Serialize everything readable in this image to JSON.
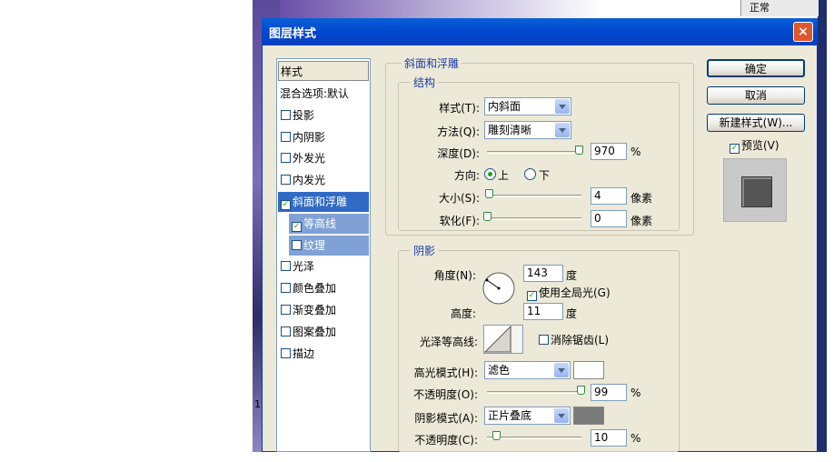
{
  "background": {
    "status_text": "正常",
    "edge_number": "1"
  },
  "dialog": {
    "title": "图层样式",
    "close": "×"
  },
  "styles_list": {
    "header": "样式",
    "items": [
      {
        "label": "混合选项:默认",
        "checkbox": false
      },
      {
        "label": "投影",
        "checkbox": true,
        "checked": false
      },
      {
        "label": "内阴影",
        "checkbox": true,
        "checked": false
      },
      {
        "label": "外发光",
        "checkbox": true,
        "checked": false
      },
      {
        "label": "内发光",
        "checkbox": true,
        "checked": false
      },
      {
        "label": "斜面和浮雕",
        "checkbox": true,
        "checked": true,
        "selected": true
      },
      {
        "label": "等高线",
        "checkbox": true,
        "checked": true,
        "sub": true
      },
      {
        "label": "纹理",
        "checkbox": true,
        "checked": false,
        "sub": true
      },
      {
        "label": "光泽",
        "checkbox": true,
        "checked": false
      },
      {
        "label": "颜色叠加",
        "checkbox": true,
        "checked": false
      },
      {
        "label": "渐变叠加",
        "checkbox": true,
        "checked": false
      },
      {
        "label": "图案叠加",
        "checkbox": true,
        "checked": false
      },
      {
        "label": "描边",
        "checkbox": true,
        "checked": false
      }
    ]
  },
  "bevel": {
    "section_title": "斜面和浮雕",
    "structure_title": "结构",
    "style_label": "样式(T):",
    "style_value": "内斜面",
    "technique_label": "方法(Q):",
    "technique_value": "雕刻清晰",
    "depth_label": "深度(D):",
    "depth_value": "970",
    "depth_unit": "%",
    "depth_slider": 0.97,
    "direction_label": "方向:",
    "direction_up": "上",
    "direction_down": "下",
    "direction_selected": "上",
    "size_label": "大小(S):",
    "size_value": "4",
    "size_unit": "像素",
    "size_slider": 0.02,
    "soften_label": "软化(F):",
    "soften_value": "0",
    "soften_unit": "像素",
    "soften_slider": 0.0
  },
  "shading": {
    "title": "阴影",
    "angle_label": "角度(N):",
    "angle_value": "143",
    "angle_unit": "度",
    "global_light_label": "使用全局光(G)",
    "global_light_checked": true,
    "altitude_label": "高度:",
    "altitude_value": "11",
    "altitude_unit": "度",
    "gloss_contour_label": "光泽等高线:",
    "antialias_label": "消除锯齿(L)",
    "antialias_checked": false,
    "highlight_mode_label": "高光模式(H):",
    "highlight_mode_value": "滤色",
    "highlight_color": "#ffffff",
    "highlight_opacity_label": "不透明度(O):",
    "highlight_opacity_value": "99",
    "highlight_opacity_unit": "%",
    "highlight_opacity_slider": 0.99,
    "shadow_mode_label": "阴影模式(A):",
    "shadow_mode_value": "正片叠底",
    "shadow_color": "#7a7a7a",
    "shadow_opacity_label": "不透明度(C):",
    "shadow_opacity_value": "10",
    "shadow_opacity_unit": "%",
    "shadow_opacity_slider": 0.1
  },
  "buttons": {
    "ok": "确定",
    "cancel": "取消",
    "new_style": "新建样式(W)...",
    "preview": "预览(V)",
    "preview_checked": true
  }
}
